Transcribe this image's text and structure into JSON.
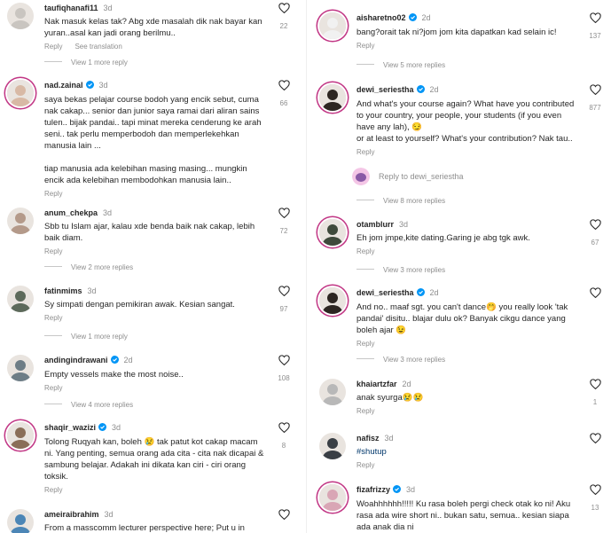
{
  "left": {
    "comments": [
      {
        "user": "taufiqhanafi11",
        "verified": false,
        "time": "3d",
        "text": [
          "Nak masuk kelas tak? Abg xde masalah dik nak bayar kan",
          "yuran..asal kan jadi orang berilmu.."
        ],
        "actions": [
          "Reply",
          "See translation"
        ],
        "likes": "22",
        "avatar": "#c9c5c0",
        "ring": false
      },
      {
        "user": "nad.zainal",
        "verified": true,
        "time": "3d",
        "text": [
          "saya bekas pelajar course bodoh yang encik sebut, cuma",
          "nak cakap... senior dan junior saya ramai dari aliran sains",
          "tulen.. bijak pandai.. tapi minat mereka cenderung ke arah",
          "seni.. tak perlu memperbodoh dan memperlekehkan",
          "manusia lain ...",
          "",
          "tiap manusia ada kelebihan masing masing... mungkin",
          "encik ada kelebihan membodohkan manusia lain.."
        ],
        "actions": [
          "Reply"
        ],
        "likes": "66",
        "avatar": "#d8b9a5",
        "ring": true
      },
      {
        "user": "anum_chekpa",
        "verified": false,
        "time": "3d",
        "text": [
          "Sbb tu Islam ajar, kalau xde benda baik nak cakap, lebih",
          "baik diam."
        ],
        "actions": [
          "Reply"
        ],
        "likes": "72",
        "avatar": "#b49a8a",
        "ring": false
      },
      {
        "user": "fatinmims",
        "verified": false,
        "time": "3d",
        "text": [
          "Sy simpati dengan pemikiran awak. Kesian sangat."
        ],
        "actions": [
          "Reply"
        ],
        "likes": "97",
        "avatar": "#5d6a5b",
        "ring": false
      },
      {
        "user": "andingindrawani",
        "verified": true,
        "time": "2d",
        "text": [
          "Empty vessels make the most noise.."
        ],
        "actions": [
          "Reply"
        ],
        "likes": "108",
        "avatar": "#6d7d86",
        "ring": false
      },
      {
        "user": "shaqir_wazizi",
        "verified": true,
        "time": "3d",
        "text": [
          "Tolong Ruqyah kan, boleh 😢 tak patut kot cakap macam",
          "ni. Yang penting, semua orang ada cita - cita nak dicapai &",
          "sambung belajar. Adakah ini dikata kan ciri - ciri orang",
          "toksik."
        ],
        "actions": [
          "Reply"
        ],
        "likes": "8",
        "avatar": "#8a6e58",
        "ring": true
      },
      {
        "user": "ameiraibrahim",
        "verified": false,
        "time": "3d",
        "text": [
          "From a masscomm lecturer perspective here; Put u in"
        ],
        "actions": [],
        "likes": "",
        "avatar": "#4c86b6",
        "ring": false
      }
    ],
    "more": [
      "View 1 more reply",
      "View 2 more replies",
      "View 1 more reply",
      "View 4 more replies"
    ]
  },
  "right": {
    "comments": [
      {
        "user": "aisharetno02",
        "verified": true,
        "time": "2d",
        "text": [
          "bang?orait tak ni?jom jom kita dapatkan kad selain ic!"
        ],
        "actions": [
          "Reply"
        ],
        "likes": "137",
        "avatar": "#f1f1f1",
        "ring": true
      },
      {
        "user": "dewi_seriestha",
        "verified": true,
        "time": "2d",
        "text": [
          "And what's your course again? What have you contributed",
          "to your country, your people, your students (if you even",
          "have any lah), 😏",
          "or at least to yourself? What's your contribution? Nak tau.."
        ],
        "actions": [
          "Reply"
        ],
        "likes": "877",
        "avatar": "#2d2622",
        "ring": true
      },
      {
        "user": "otamblurr",
        "verified": false,
        "time": "3d",
        "text": [
          "Eh jom jmpe,kite dating.Garing je abg tgk awk."
        ],
        "actions": [
          "Reply"
        ],
        "likes": "67",
        "avatar": "#3f4a3c",
        "ring": true
      },
      {
        "user": "dewi_seriestha",
        "verified": true,
        "time": "2d",
        "text": [
          "And no.. maaf sgt. you can't dance🤭 you really look 'tak",
          "pandai' disitu.. blajar dulu ok? Banyak cikgu dance yang",
          "boleh ajar 😉"
        ],
        "actions": [
          "Reply"
        ],
        "likes": "",
        "avatar": "#2d2622",
        "ring": true
      },
      {
        "user": "khaiartzfar",
        "verified": false,
        "time": "2d",
        "text": [
          "anak syurga😢😢"
        ],
        "actions": [
          "Reply"
        ],
        "likes": "1",
        "avatar": "#b8b8b8",
        "ring": false
      },
      {
        "user": "nafisz",
        "verified": false,
        "time": "3d",
        "text": [
          "#shutup"
        ],
        "actions": [
          "Reply"
        ],
        "likes": "",
        "avatar": "#3a3f45",
        "ring": false
      },
      {
        "user": "fizafrizzy",
        "verified": true,
        "time": "3d",
        "text": [
          "Woahhhhhh!!!!! Ku rasa boleh pergi check otak ko ni! Aku",
          "rasa ada wire short ni.. bukan satu, semua.. kesian siapa",
          "ada anak dia ni"
        ],
        "actions": [],
        "likes": "13",
        "avatar": "#d9a6b5",
        "ring": true
      }
    ],
    "more": [
      "View 5 more replies",
      "View 8 more replies",
      "View 3 more replies",
      "View 3 more replies"
    ],
    "reply_placeholder": "Reply to dewi_seriestha"
  },
  "colors": {
    "verified": "#0095f6",
    "muted": "#8e8e8e",
    "text": "#262626",
    "link": "#00376b"
  },
  "icons": {
    "like": "heart-outline-icon",
    "verified": "verified-badge-icon"
  }
}
